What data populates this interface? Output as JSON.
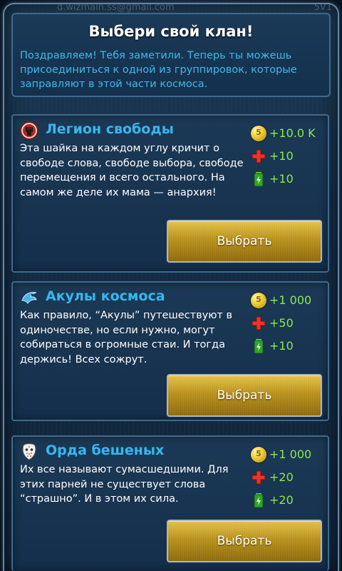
{
  "statusbar": {
    "user": "d.wizmain.ss@gmail.com",
    "right": "5V1"
  },
  "header": {
    "title": "Выбери свой клан!",
    "intro": "Поздравляем! Тебя заметили. Теперь ты можешь присоединиться к одной из группировок, которые заправляют в этой части космоса."
  },
  "icons": {
    "coin": "5",
    "health": "red-cross-icon",
    "energy": "green-battery-icon"
  },
  "colors": {
    "title": "#ffffff",
    "intro": "#41b9e8",
    "clan_name": "#37b7ef",
    "stat": "#8fe84a",
    "button": "#c29a24"
  },
  "clans": [
    {
      "name": "Легион свободы",
      "emblem": "fist-emblem-icon",
      "description": "Эта шайка на каждом углу кричит о свободе слова, свободе выбора, свободе перемещения и всего остального. На самом же деле их мама — анархия!",
      "coins": "+10.0 K",
      "health": "+10",
      "energy": "+10",
      "button": "Выбрать"
    },
    {
      "name": "Акулы космоса",
      "emblem": "shark-emblem-icon",
      "description": "Как правило, “Акулы” путешествуют в одиночестве, но если нужно, могут собираться в огромные стаи. И тогда держись! Всех сожрут.",
      "coins": "+1 000",
      "health": "+50",
      "energy": "+10",
      "button": "Выбрать"
    },
    {
      "name": "Орда бешеных",
      "emblem": "hockey-mask-icon",
      "description": "Их все называют сумасшедшими. Для этих парней не существует слова “страшно”. И в этом их сила.",
      "coins": "+1 000",
      "health": "+20",
      "energy": "+20",
      "button": "Выбрать"
    }
  ]
}
